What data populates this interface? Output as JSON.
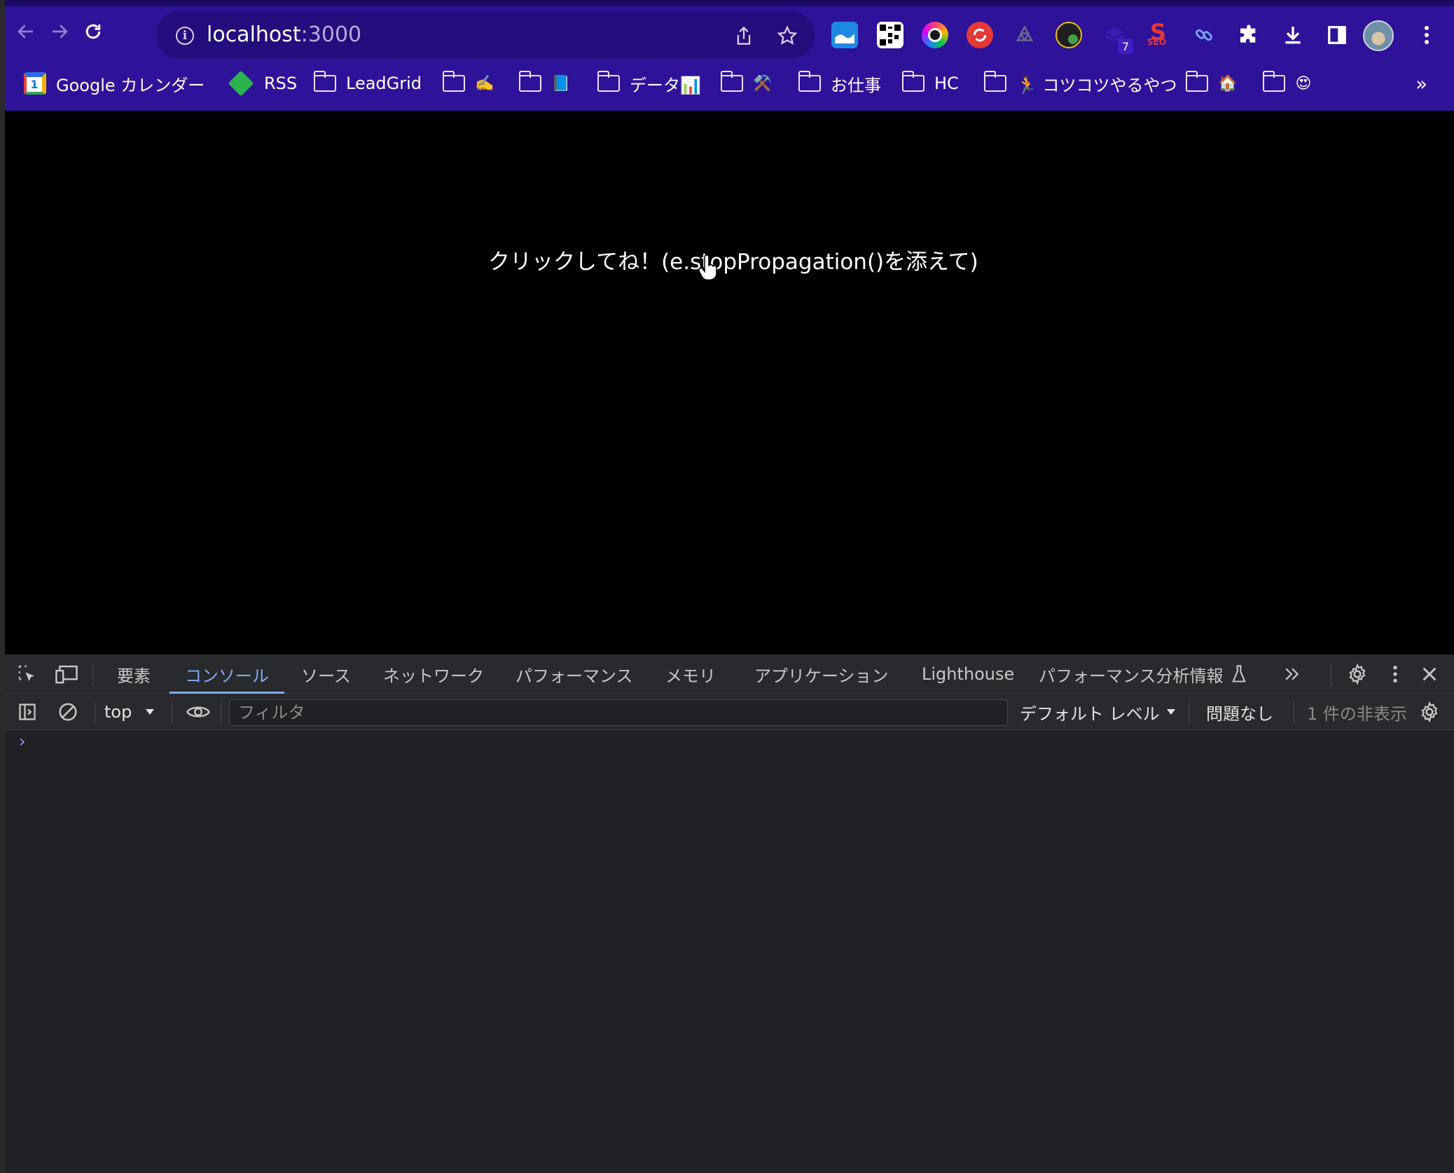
{
  "browser": {
    "url_host": "localhost",
    "url_port": ":3000",
    "extension_badge": "7",
    "extension_seo_label": "SEO",
    "bookmarks": [
      {
        "label": "Google カレンダー",
        "icon": "google-calendar-icon",
        "badge": "1"
      },
      {
        "label": "RSS",
        "icon": "feedly-icon"
      },
      {
        "label": "LeadGrid",
        "icon": "folder-icon"
      },
      {
        "label": "✍️",
        "icon": "folder-icon"
      },
      {
        "label": "📘",
        "icon": "folder-icon"
      },
      {
        "label": "データ📊",
        "icon": "folder-icon"
      },
      {
        "label": "⚒️",
        "icon": "folder-icon"
      },
      {
        "label": "お仕事",
        "icon": "folder-icon"
      },
      {
        "label": "HC",
        "icon": "folder-icon"
      },
      {
        "label": "🏃 コツコツやるやつ",
        "icon": "folder-icon"
      },
      {
        "label": "🏠",
        "icon": "folder-icon"
      },
      {
        "label": "😍",
        "icon": "folder-icon"
      }
    ],
    "more_bookmarks": "»"
  },
  "page": {
    "click_text": "クリックしてね！(e.stopPropagation()を添えて)"
  },
  "devtools": {
    "tabs": [
      {
        "label": "要素",
        "active": false
      },
      {
        "label": "コンソール",
        "active": true
      },
      {
        "label": "ソース",
        "active": false
      },
      {
        "label": "ネットワーク",
        "active": false
      },
      {
        "label": "パフォーマンス",
        "active": false
      },
      {
        "label": "メモリ",
        "active": false
      },
      {
        "label": "アプリケーション",
        "active": false
      },
      {
        "label": "Lighthouse",
        "active": false
      },
      {
        "label": "パフォーマンス分析情報",
        "active": false
      }
    ],
    "console": {
      "context": "top",
      "filter_placeholder": "フィルタ",
      "default_levels": "デフォルト レベル",
      "issues": "問題なし",
      "hidden_count": "1 件の非表示",
      "prompt": "›"
    }
  },
  "colors": {
    "chrome_bg": "#2e139a",
    "omnibox_bg": "#240e7d",
    "devtools_bg": "#202124",
    "active_tab": "#7cacf8"
  }
}
